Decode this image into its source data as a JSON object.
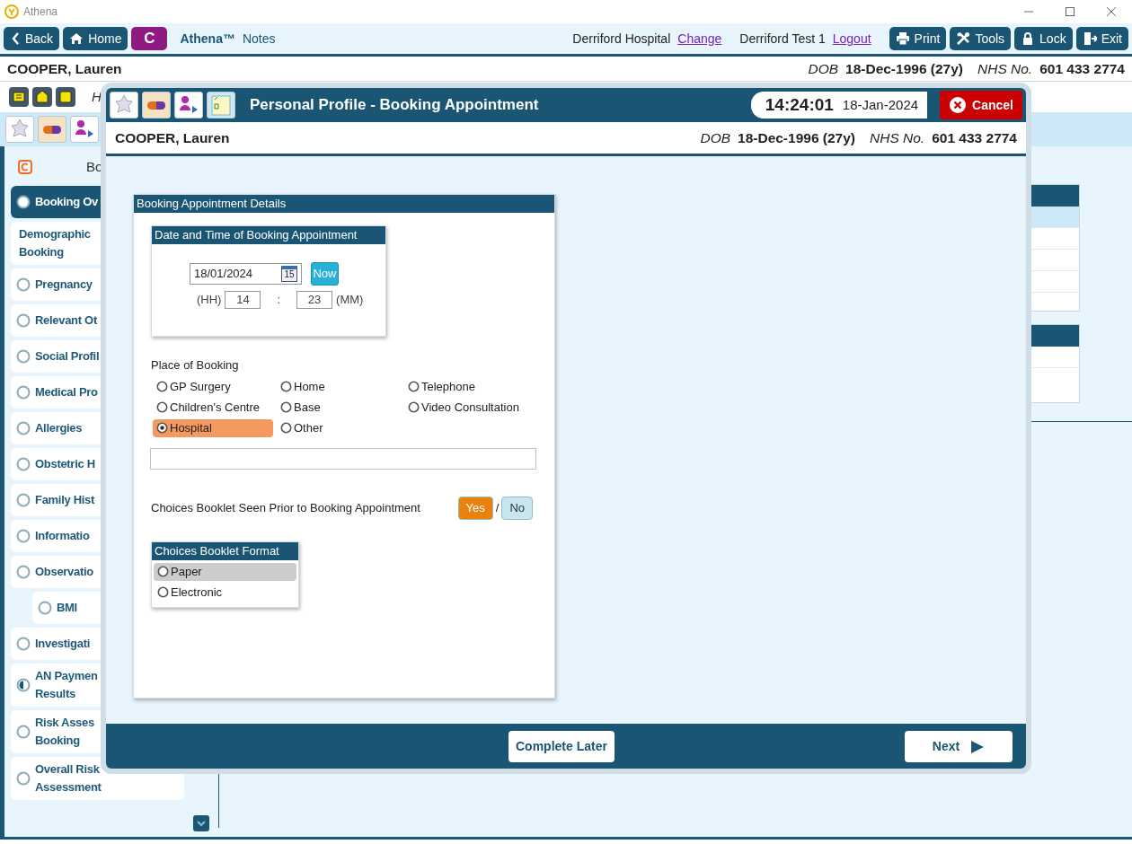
{
  "app": {
    "title": "Athena"
  },
  "toolbar": {
    "left_buttons": [
      {
        "kind": "back",
        "label": "Back"
      },
      {
        "kind": "home",
        "label": "Home"
      },
      {
        "kind": "letter",
        "label": "C"
      }
    ],
    "brand": "Athena™",
    "brand_sub": "Notes",
    "location": "Derriford Hospital",
    "location_link": "Change",
    "user": "Derriford Test 1",
    "user_link": "Logout",
    "right_buttons": [
      {
        "kind": "print",
        "label": "Print"
      },
      {
        "kind": "tools",
        "label": "Tools"
      },
      {
        "kind": "lock",
        "label": "Lock"
      },
      {
        "kind": "exit",
        "label": "Exit"
      }
    ]
  },
  "patient": {
    "name": "COOPER, Lauren",
    "dob_label": "DOB",
    "dob": "18-Dec-1996 (27y)",
    "nhs_label": "NHS No.",
    "nhs": "601 433 2774"
  },
  "help_row": {
    "text": "H"
  },
  "sidebar": {
    "heading": "Bo",
    "items": [
      {
        "label": "Booking Ov",
        "kind": "circle",
        "selected": true
      },
      {
        "label": "Demographic\nBooking",
        "kind": "plain",
        "selected": false
      },
      {
        "label": "Pregnancy",
        "kind": "circle",
        "selected": false
      },
      {
        "label": "Relevant Ot",
        "kind": "circle",
        "selected": false
      },
      {
        "label": "Social Profil",
        "kind": "circle",
        "selected": false
      },
      {
        "label": "Medical Pro",
        "kind": "circle",
        "selected": false
      },
      {
        "label": "Allergies",
        "kind": "circle",
        "selected": false
      },
      {
        "label": "Obstetric H",
        "kind": "circle",
        "selected": false
      },
      {
        "label": "Family Hist",
        "kind": "circle",
        "selected": false
      },
      {
        "label": "Informatio",
        "kind": "circle",
        "selected": false
      },
      {
        "label": "Observatio",
        "kind": "circle",
        "selected": false,
        "children": [
          {
            "label": "BMI",
            "kind": "circle",
            "selected": false
          }
        ]
      },
      {
        "label": "Investigati",
        "kind": "circle",
        "selected": false
      },
      {
        "label": "AN Paymen\nResults",
        "kind": "half",
        "selected": false
      },
      {
        "label": "Risk Asses\nBooking",
        "kind": "circle",
        "selected": false
      },
      {
        "label": "Overall Risk\nAssessment",
        "kind": "circle",
        "selected": false
      }
    ]
  },
  "dialog": {
    "title": "Personal Profile - Booking Appointment",
    "time": "14:24:01",
    "date": "18-Jan-2024",
    "cancel": "Cancel",
    "patient": {
      "name": "COOPER, Lauren",
      "dob_label": "DOB",
      "dob": "18-Dec-1996 (27y)",
      "nhs_label": "NHS No.",
      "nhs": "601 433 2774"
    },
    "section": {
      "title": "Booking Appointment Details",
      "datetime": {
        "title": "Date and Time of Booking Appointment",
        "date": "18/01/2024",
        "calendar_day": "15",
        "now": "Now",
        "hh_label": "(HH)",
        "hh": "14",
        "separator": ":",
        "mm": "23",
        "mm_label": "(MM)"
      },
      "place": {
        "label": "Place of Booking",
        "options": [
          {
            "label": "GP Surgery",
            "selected": false
          },
          {
            "label": "Home",
            "selected": false
          },
          {
            "label": "Telephone",
            "selected": false
          },
          {
            "label": "Children's Centre",
            "selected": false
          },
          {
            "label": "Base",
            "selected": false
          },
          {
            "label": "Video Consultation",
            "selected": false
          },
          {
            "label": "Hospital",
            "selected": true
          },
          {
            "label": "Other",
            "selected": false
          }
        ]
      },
      "booklet_seen": {
        "label": "Choices Booklet Seen Prior to Booking Appointment",
        "separator": "/",
        "options": [
          {
            "label": "Yes",
            "selected": true
          },
          {
            "label": "No",
            "selected": false
          }
        ]
      },
      "format": {
        "title": "Choices Booklet Format",
        "options": [
          {
            "label": "Paper",
            "selected": false,
            "highlighted": true
          },
          {
            "label": "Electronic",
            "selected": false,
            "highlighted": false
          }
        ]
      }
    },
    "footer": {
      "complete_later": "Complete Later",
      "next": "Next"
    }
  }
}
